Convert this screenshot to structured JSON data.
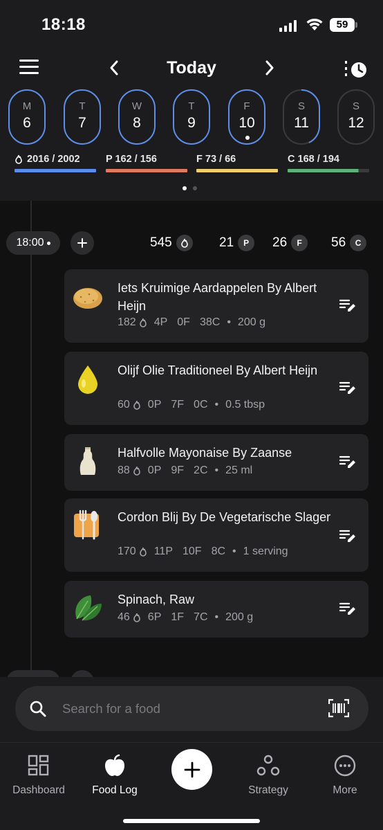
{
  "status_bar": {
    "time": "18:18",
    "battery": "59"
  },
  "header": {
    "title": "Today",
    "days": [
      {
        "letter": "M",
        "num": "6",
        "ring": "full"
      },
      {
        "letter": "T",
        "num": "7",
        "ring": "full"
      },
      {
        "letter": "W",
        "num": "8",
        "ring": "full"
      },
      {
        "letter": "T",
        "num": "9",
        "ring": "full"
      },
      {
        "letter": "F",
        "num": "10",
        "ring": "full",
        "selected": true
      },
      {
        "letter": "S",
        "num": "11",
        "ring": "partial"
      },
      {
        "letter": "S",
        "num": "12",
        "ring": "none"
      }
    ],
    "macros": [
      {
        "label": "2016 / 2002",
        "color": "#5b8def",
        "icon": "flame-icon"
      },
      {
        "label": "P 162 / 156",
        "color": "#e07a5f"
      },
      {
        "label": "F 73 / 66",
        "color": "#f2cf6a"
      },
      {
        "label": "C 168 / 194",
        "color": "#5fb07a",
        "fill": 0.87
      }
    ]
  },
  "meal": {
    "time": "18:00",
    "totals": {
      "kcal": "545",
      "p": "21",
      "f": "26",
      "c": "56"
    },
    "badges": {
      "p": "P",
      "f": "F",
      "c": "C"
    }
  },
  "foods": [
    {
      "name": "Iets Kruimige Aardappelen By Albert Heijn",
      "icon": "potato-icon",
      "kcal": "182",
      "p": "4P",
      "f": "0F",
      "c": "38C",
      "amount": "200 g"
    },
    {
      "name": "Olijf Olie Traditioneel By Albert Heijn",
      "icon": "oil-drop-icon",
      "kcal": "60",
      "p": "0P",
      "f": "7F",
      "c": "0C",
      "amount": "0.5 tbsp"
    },
    {
      "name": "Halfvolle Mayonaise By Zaanse",
      "icon": "mayonnaise-bottle-icon",
      "kcal": "88",
      "p": "0P",
      "f": "9F",
      "c": "2C",
      "amount": "25 ml"
    },
    {
      "name": "Cordon Blij By De Vegetarische Slager",
      "icon": "cutlery-icon",
      "kcal": "170",
      "p": "11P",
      "f": "10F",
      "c": "8C",
      "amount": "1 serving"
    },
    {
      "name": "Spinach, Raw",
      "icon": "spinach-icon",
      "kcal": "46",
      "p": "6P",
      "f": "1F",
      "c": "7C",
      "amount": "200 g"
    }
  ],
  "search": {
    "placeholder": "Search for a food"
  },
  "tabs": [
    {
      "label": "Dashboard",
      "icon": "dashboard-icon"
    },
    {
      "label": "Food Log",
      "icon": "apple-icon",
      "active": true
    },
    {
      "label": "Strategy",
      "icon": "strategy-icon"
    },
    {
      "label": "More",
      "icon": "more-icon"
    }
  ]
}
